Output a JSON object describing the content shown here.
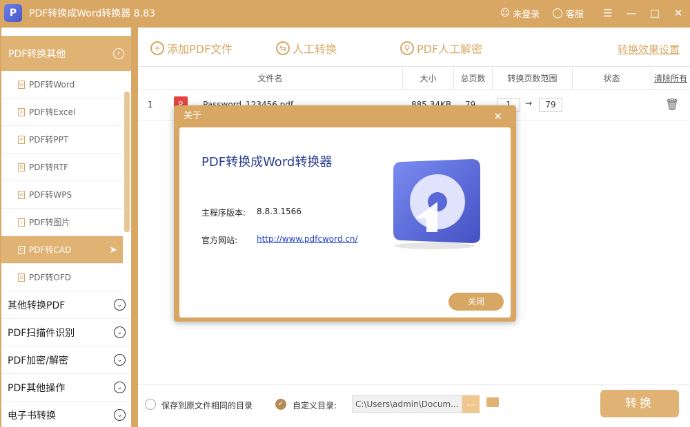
{
  "titlebar": {
    "title": "PDF转换成Word转换器 8.83",
    "login": "未登录",
    "service": "客服"
  },
  "sidebar": {
    "header": "PDF转换其他",
    "sub_items": [
      {
        "label": "PDF转Word",
        "icon": "word-file-icon"
      },
      {
        "label": "PDF转Excel",
        "icon": "excel-file-icon"
      },
      {
        "label": "PDF转PPT",
        "icon": "ppt-file-icon"
      },
      {
        "label": "PDF转RTF",
        "icon": "rtf-file-icon"
      },
      {
        "label": "PDF转WPS",
        "icon": "wps-file-icon"
      },
      {
        "label": "PDF转图片",
        "icon": "image-file-icon"
      },
      {
        "label": "PDF转CAD",
        "icon": "cad-file-icon",
        "active": true
      },
      {
        "label": "PDF转OFD",
        "icon": "ofd-file-icon"
      }
    ],
    "groups": [
      "其他转换PDF",
      "PDF扫描件识别",
      "PDF加密/解密",
      "PDF其他操作",
      "电子书转换"
    ]
  },
  "toolbar": {
    "add_pdf": "添加PDF文件",
    "manual_convert": "人工转换",
    "manual_decrypt": "PDF人工解密",
    "settings": "转换效果设置"
  },
  "table": {
    "headers": {
      "filename": "文件名",
      "size": "大小",
      "pages": "总页数",
      "range": "转换页数范围",
      "status": "状态",
      "clear": "清除所有"
    },
    "rows": [
      {
        "index": "1",
        "filename": "Password_123456.pdf",
        "size": "885.34KB",
        "pages": "79",
        "from": "1",
        "to": "79"
      }
    ]
  },
  "bottom": {
    "same_dir": "保存到原文件相同的目录",
    "custom_dir": "自定义目录:",
    "path": "C:\\Users\\admin\\Docum...",
    "dots": "...",
    "convert": "转换"
  },
  "modal": {
    "title": "关于",
    "heading": "PDF转换成Word转换器",
    "version_label": "主程序版本:",
    "version": "8.8.3.1566",
    "site_label": "官方网站:",
    "site": "http://www.pdfcword.cn/",
    "close": "关闭"
  },
  "colors": {
    "accent": "#d9a764",
    "accent_light": "#e0b273",
    "link": "#1a3cc8",
    "heading": "#2a3d8f"
  }
}
